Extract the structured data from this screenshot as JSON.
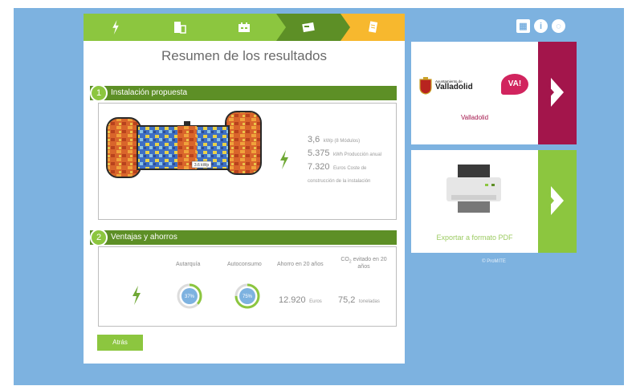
{
  "steps": [
    {
      "icon": "lightning-icon",
      "color": "#8cc63f"
    },
    {
      "icon": "building-icon",
      "color": "#8cc63f"
    },
    {
      "icon": "roof-panel-icon",
      "color": "#8cc63f"
    },
    {
      "icon": "calculator-icon",
      "color": "#5d8f26"
    },
    {
      "icon": "document-icon",
      "color": "#f7b82e"
    }
  ],
  "main": {
    "title": "Resumen de los resultados",
    "back_label": "Atrás"
  },
  "section1": {
    "number": "1",
    "title": "Instalación propuesta",
    "roof_label": "3.6 kWp",
    "power_value": "3,6",
    "power_unit": "kWp (8 Módulos)",
    "production_value": "5.375",
    "production_unit": "kWh Producción anual",
    "cost_value": "7.320",
    "cost_unit": "Euros Coste de construcción de la instalación"
  },
  "section2": {
    "number": "2",
    "title": "Ventajas y ahorros",
    "col_autarquia": "Autarquía",
    "col_autoconsumo": "Autoconsumo",
    "col_ahorro": "Ahorro en 20 años",
    "col_co2": "CO",
    "col_co2_sub": "2",
    "col_co2_rest": "evitado en 20 años",
    "autarquia_value": "37%",
    "autarquia_fraction": 0.37,
    "autoconsumo_value": "75%",
    "autoconsumo_fraction": 0.75,
    "ahorro_value": "12.920",
    "ahorro_unit": "Euros",
    "co2_value": "75,2",
    "co2_unit": "toneladas"
  },
  "sidebar": {
    "card1_city_small": "Ayuntamiento de",
    "card1_city_big": "Valladolid",
    "card1_va_logo": "VA!",
    "card1_label": "Valladolid",
    "card1_color": "#a3154b",
    "card2_label": "Exportar a formato PDF",
    "card2_color": "#8cc63f",
    "copyright": "© ProMITE"
  },
  "colors": {
    "background": "#7db2e0",
    "green_dark": "#5d8f26",
    "green_light": "#8cc63f"
  }
}
